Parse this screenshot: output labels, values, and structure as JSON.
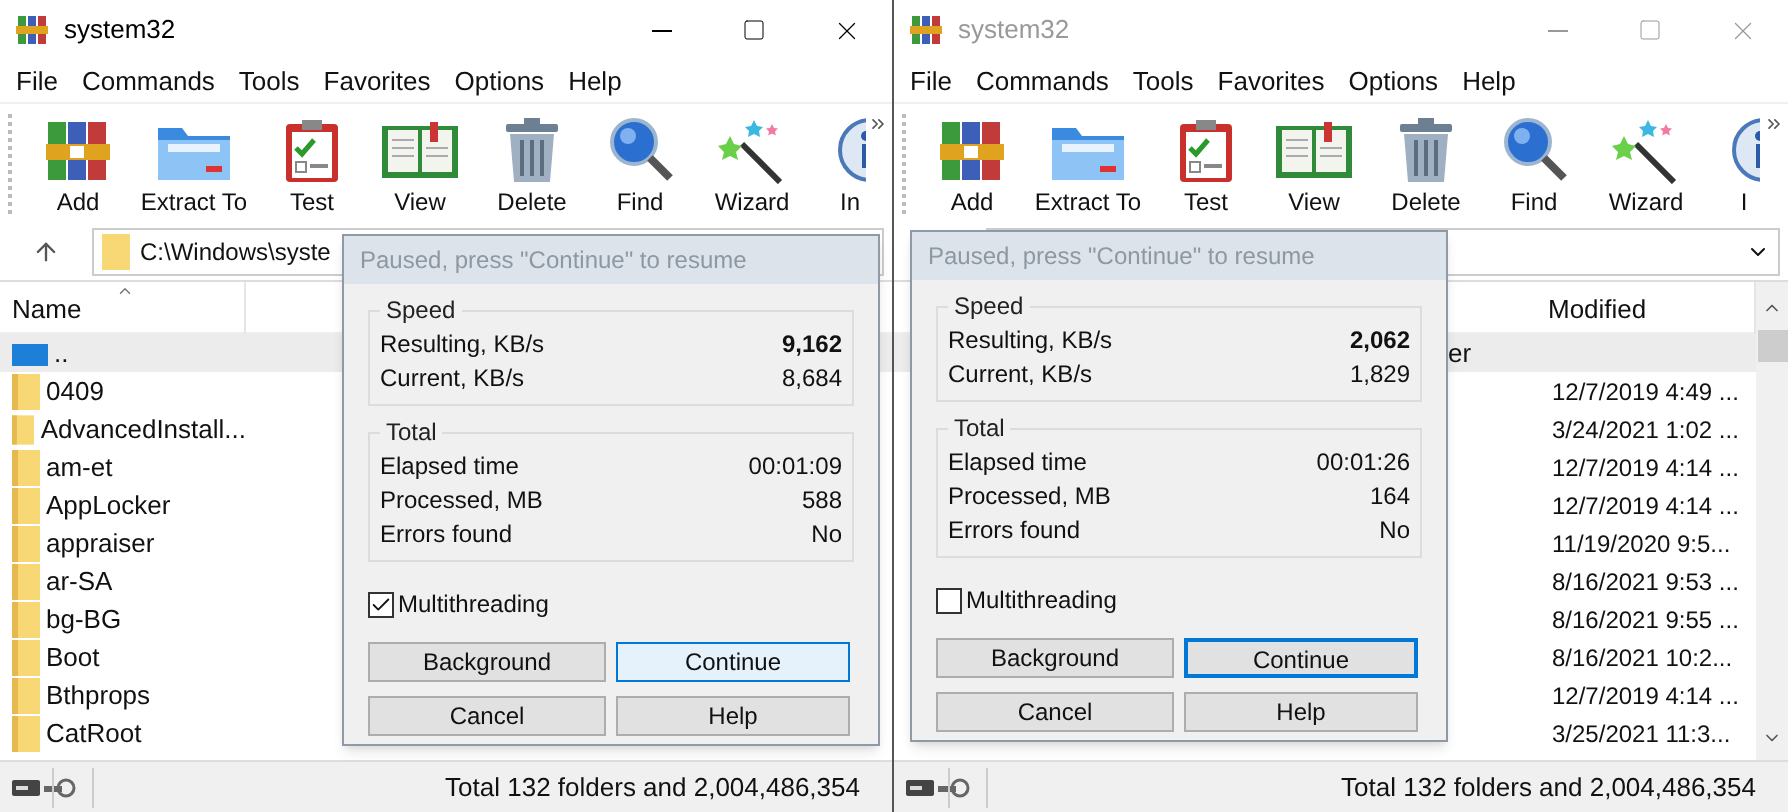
{
  "windows": [
    {
      "title": "system32",
      "active": true,
      "menu": [
        "File",
        "Commands",
        "Tools",
        "Favorites",
        "Options",
        "Help"
      ],
      "toolbar": [
        {
          "label": "Add",
          "kind": "add"
        },
        {
          "label": "Extract To",
          "kind": "extract"
        },
        {
          "label": "Test",
          "kind": "test"
        },
        {
          "label": "View",
          "kind": "view"
        },
        {
          "label": "Delete",
          "kind": "delete"
        },
        {
          "label": "Find",
          "kind": "find"
        },
        {
          "label": "Wizard",
          "kind": "wizard"
        },
        {
          "label": "In",
          "kind": "info"
        }
      ],
      "address": {
        "value": "C:\\Windows\\syste"
      },
      "columns": [
        {
          "label": "Name",
          "kind": "name",
          "sorted": true
        }
      ],
      "rows": [
        {
          "name": "..",
          "kind": "parent",
          "selected": true
        },
        {
          "name": "0409",
          "kind": "folder",
          "selected": false
        },
        {
          "name": "AdvancedInstall...",
          "kind": "folder",
          "selected": false
        },
        {
          "name": "am-et",
          "kind": "folder",
          "selected": false
        },
        {
          "name": "AppLocker",
          "kind": "folder",
          "selected": false
        },
        {
          "name": "appraiser",
          "kind": "folder",
          "selected": false
        },
        {
          "name": "ar-SA",
          "kind": "folder",
          "selected": false
        },
        {
          "name": "bg-BG",
          "kind": "folder",
          "selected": false
        },
        {
          "name": "Boot",
          "kind": "folder",
          "selected": false
        },
        {
          "name": "Bthprops",
          "kind": "folder",
          "selected": false
        },
        {
          "name": "CatRoot",
          "kind": "folder",
          "selected": false
        }
      ],
      "status": "Total 132 folders and 2,004,486,354",
      "dialog": {
        "title": "Paused, press \"Continue\" to resume",
        "groups": [
          {
            "title": "Speed",
            "rows": [
              {
                "label": "Resulting, KB/s",
                "value": "9,162",
                "bold": true
              },
              {
                "label": "Current, KB/s",
                "value": "8,684",
                "bold": false
              }
            ]
          },
          {
            "title": "Total",
            "rows": [
              {
                "label": "Elapsed time",
                "value": "00:01:09",
                "bold": false
              },
              {
                "label": "Processed, MB",
                "value": "588",
                "bold": false
              },
              {
                "label": "Errors found",
                "value": "No",
                "bold": false
              }
            ]
          }
        ],
        "multithreading": {
          "label": "Multithreading",
          "checked": true
        },
        "buttons": [
          {
            "label": "Background",
            "hovered": false,
            "focused": false
          },
          {
            "label": "Continue",
            "hovered": true,
            "focused": false
          },
          {
            "label": "Cancel",
            "hovered": false,
            "focused": false
          },
          {
            "label": "Help",
            "hovered": false,
            "focused": false
          }
        ]
      }
    },
    {
      "title": "system32",
      "active": false,
      "menu": [
        "File",
        "Commands",
        "Tools",
        "Favorites",
        "Options",
        "Help"
      ],
      "toolbar": [
        {
          "label": "Add",
          "kind": "add"
        },
        {
          "label": "Extract To",
          "kind": "extract"
        },
        {
          "label": "Test",
          "kind": "test"
        },
        {
          "label": "View",
          "kind": "view"
        },
        {
          "label": "Delete",
          "kind": "delete"
        },
        {
          "label": "Find",
          "kind": "find"
        },
        {
          "label": "Wizard",
          "kind": "wizard"
        },
        {
          "label": "I",
          "kind": "info"
        }
      ],
      "columns": [
        {
          "label": "Modified",
          "kind": "modified",
          "sorted": false
        }
      ],
      "rows": [
        {
          "type": "er",
          "selected": true
        },
        {
          "modified": "12/7/2019 4:49 ...",
          "selected": false
        },
        {
          "modified": "3/24/2021 1:02 ...",
          "selected": false
        },
        {
          "modified": "12/7/2019 4:14 ...",
          "selected": false
        },
        {
          "modified": "12/7/2019 4:14 ...",
          "selected": false
        },
        {
          "modified": "11/19/2020 9:5...",
          "selected": false
        },
        {
          "modified": "8/16/2021 9:53 ...",
          "selected": false
        },
        {
          "modified": "8/16/2021 9:55 ...",
          "selected": false
        },
        {
          "modified": "8/16/2021 10:2...",
          "selected": false
        },
        {
          "modified": "12/7/2019 4:14 ...",
          "selected": false
        },
        {
          "modified": "3/25/2021 11:3...",
          "selected": false
        }
      ],
      "status": "Total 132 folders and 2,004,486,354",
      "dialog": {
        "title": "Paused, press \"Continue\" to resume",
        "groups": [
          {
            "title": "Speed",
            "rows": [
              {
                "label": "Resulting, KB/s",
                "value": "2,062",
                "bold": true
              },
              {
                "label": "Current, KB/s",
                "value": "1,829",
                "bold": false
              }
            ]
          },
          {
            "title": "Total",
            "rows": [
              {
                "label": "Elapsed time",
                "value": "00:01:26",
                "bold": false
              },
              {
                "label": "Processed, MB",
                "value": "164",
                "bold": false
              },
              {
                "label": "Errors found",
                "value": "No",
                "bold": false
              }
            ]
          }
        ],
        "multithreading": {
          "label": "Multithreading",
          "checked": false
        },
        "buttons": [
          {
            "label": "Background",
            "hovered": false,
            "focused": false
          },
          {
            "label": "Continue",
            "hovered": false,
            "focused": true
          },
          {
            "label": "Cancel",
            "hovered": false,
            "focused": false
          },
          {
            "label": "Help",
            "hovered": false,
            "focused": false
          }
        ]
      }
    }
  ]
}
